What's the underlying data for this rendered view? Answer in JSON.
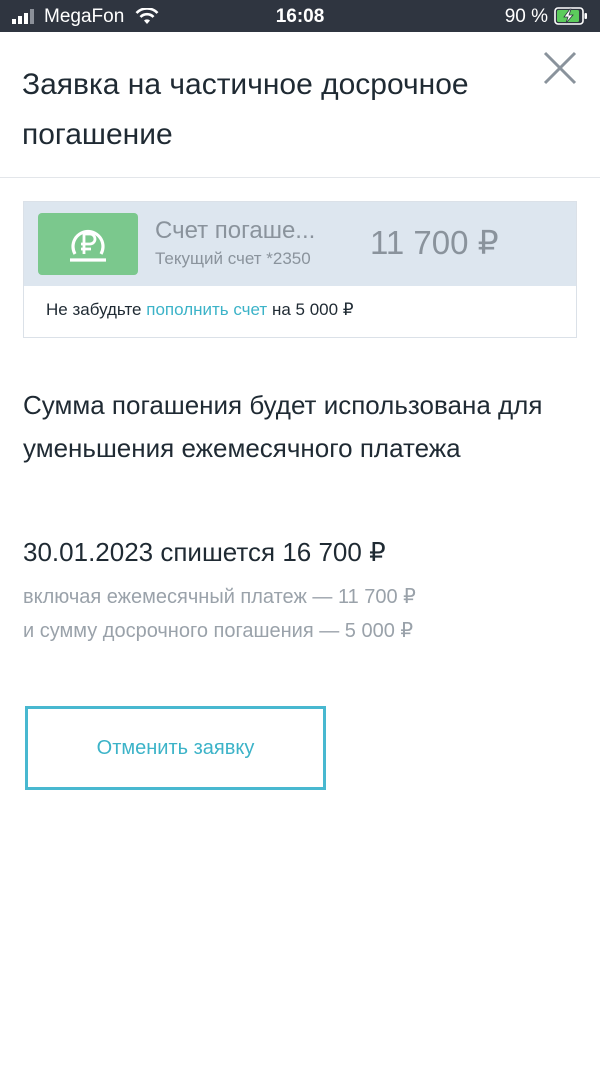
{
  "status_bar": {
    "carrier": "MegaFon",
    "time": "16:08",
    "battery": "90 %",
    "signal_icon": "signal-bars-icon",
    "wifi_icon": "wifi-icon",
    "battery_icon": "battery-charging-icon"
  },
  "header": {
    "title": "Заявка на частичное досрочное погашение",
    "close_icon": "close-icon"
  },
  "account": {
    "icon": "ruble-coin-icon",
    "name": "Счет погаше...",
    "subtitle": "Текущий счет *2350",
    "amount": "11 700 ₽",
    "note_prefix": "Не забудьте",
    "note_link": "пополнить счет",
    "note_suffix": "на 5 000 ₽"
  },
  "info": {
    "text": "Сумма погашения будет использована для уменьшения ежемесячного платежа",
    "charge_line": "30.01.2023 спишется 16 700 ₽",
    "detail_monthly": "включая ежемесячный платеж — 11 700 ₽",
    "detail_early": "и сумму досрочного погашения — 5 000 ₽"
  },
  "actions": {
    "cancel_label": "Отменить заявку"
  },
  "colors": {
    "status_bar_bg": "#2f3540",
    "accent": "#3cb3c8",
    "account_bg": "#dde6ef",
    "icon_green": "#7bc88d",
    "muted_text": "#8a939c"
  }
}
